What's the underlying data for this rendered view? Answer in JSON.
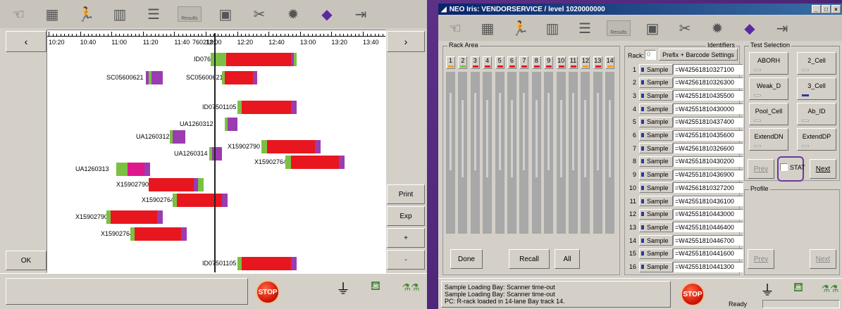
{
  "left": {
    "toolbar": {
      "buttons": [
        {
          "icon": "pipette-hand-icon"
        },
        {
          "icon": "tray-icon"
        },
        {
          "icon": "running-man-icon"
        },
        {
          "icon": "racks-icon"
        },
        {
          "icon": "document-icon"
        },
        {
          "icon": "results-icon",
          "label": "Results"
        },
        {
          "icon": "calendar-icon"
        },
        {
          "icon": "tools-icon"
        },
        {
          "icon": "gear-icon"
        },
        {
          "icon": "book-icon"
        },
        {
          "icon": "exit-icon"
        }
      ]
    },
    "nav": {
      "prev": "‹",
      "next": "›",
      "ok": "OK"
    },
    "side_buttons": {
      "print": "Print",
      "exp": "Exp",
      "plus": "+",
      "minus": "-"
    },
    "timeline": {
      "ticks": [
        "10:20",
        "10:40",
        "11:00",
        "11:20",
        "11:40",
        "12:00",
        "12:20",
        "12:40",
        "13:00",
        "13:20",
        "13:40"
      ],
      "header_overlap_label": "7602191",
      "rows": [
        {
          "label": "ID07602191"
        },
        {
          "label": "SC05600621"
        },
        {
          "label": "SC05600621"
        },
        {
          "label": "ID07501105"
        },
        {
          "label": "UA1260312"
        },
        {
          "label": "UA1260312"
        },
        {
          "label": "X15902790"
        },
        {
          "label": "UA1260314"
        },
        {
          "label": "X15902764"
        },
        {
          "label": "UA1260313"
        },
        {
          "label": "X15902790"
        },
        {
          "label": "X15902764"
        },
        {
          "label": "X15902790"
        },
        {
          "label": "X15902764"
        },
        {
          "label": "ID07501105"
        }
      ]
    },
    "colors": {
      "red": "#e8161e",
      "green": "#7ac143",
      "purple": "#9b3cb0",
      "magenta": "#e0168c",
      "current_line": "#222222"
    }
  },
  "right": {
    "title": "NEO Iris: VENDORSERVICE / level 1020000000",
    "toolbar": {
      "buttons": [
        {
          "icon": "pipette-hand-icon"
        },
        {
          "icon": "tray-icon"
        },
        {
          "icon": "running-man-icon"
        },
        {
          "icon": "racks-icon"
        },
        {
          "icon": "document-icon"
        },
        {
          "icon": "results-icon",
          "label": "Results"
        },
        {
          "icon": "calendar-icon"
        },
        {
          "icon": "tools-icon"
        },
        {
          "icon": "gear-icon"
        },
        {
          "icon": "book-icon"
        },
        {
          "icon": "exit-icon"
        }
      ]
    },
    "rack_area": {
      "caption": "Rack Area",
      "columns": [
        "1",
        "2",
        "3",
        "4",
        "5",
        "6",
        "7",
        "8",
        "9",
        "10",
        "11",
        "12",
        "13",
        "14"
      ],
      "column_status": [
        "orange",
        "green",
        "red",
        "red",
        "red",
        "red",
        "red",
        "red",
        "red",
        "red",
        "red",
        "orange",
        "red",
        "orange"
      ]
    },
    "identifiers": {
      "caption": "Identifiers",
      "rack_label": "Rack:",
      "rack_value": "0",
      "prefix_button": "Prefix + Barcode Settings",
      "sample_label": "Sample",
      "rows": [
        {
          "num": "1",
          "value": "=W42561810327100"
        },
        {
          "num": "2",
          "value": "=W42561810326300"
        },
        {
          "num": "3",
          "value": "=W42551810435500"
        },
        {
          "num": "4",
          "value": "=W42551810430000"
        },
        {
          "num": "5",
          "value": "=W42551810437400"
        },
        {
          "num": "6",
          "value": "=W42551810435600"
        },
        {
          "num": "7",
          "value": "=W42561810326600"
        },
        {
          "num": "8",
          "value": "=W42551810430200"
        },
        {
          "num": "9",
          "value": "=W42551810436900"
        },
        {
          "num": "10",
          "value": "=W42561810327200"
        },
        {
          "num": "11",
          "value": "=W42551810436100"
        },
        {
          "num": "12",
          "value": "=W42551810443000"
        },
        {
          "num": "13",
          "value": "=W42551810446400"
        },
        {
          "num": "14",
          "value": "=W42551810446700"
        },
        {
          "num": "15",
          "value": "=W42551810441600"
        },
        {
          "num": "16",
          "value": "=W42551810441300"
        }
      ]
    },
    "test_selection": {
      "caption": "Test Selection",
      "tests": [
        {
          "label": "ABORH",
          "selected": false
        },
        {
          "label": "2_Cell",
          "selected": false
        },
        {
          "label": "Weak_D",
          "selected": false
        },
        {
          "label": "3_Cell",
          "selected": true
        },
        {
          "label": "Pool_Cell",
          "selected": false
        },
        {
          "label": "Ab_ID",
          "selected": false
        },
        {
          "label": "ExtendDN",
          "selected": false
        },
        {
          "label": "ExtendDP",
          "selected": false
        }
      ],
      "prev": "Prev",
      "stat": "STAT",
      "next": "Next"
    },
    "profile": {
      "caption": "Profile",
      "prev": "Prev",
      "next": "Next"
    },
    "bottom_buttons": {
      "done": "Done",
      "recall": "Recall",
      "all": "All"
    },
    "status_messages": [
      "Sample Loading Bay: Scanner time-out",
      "Sample Loading Bay: Scanner time-out",
      "PC: R-rack loaded in 14-lane Bay track 14."
    ],
    "status": "Ready",
    "stop_label": "STOP",
    "highlight_color": "#6a3aa0"
  }
}
